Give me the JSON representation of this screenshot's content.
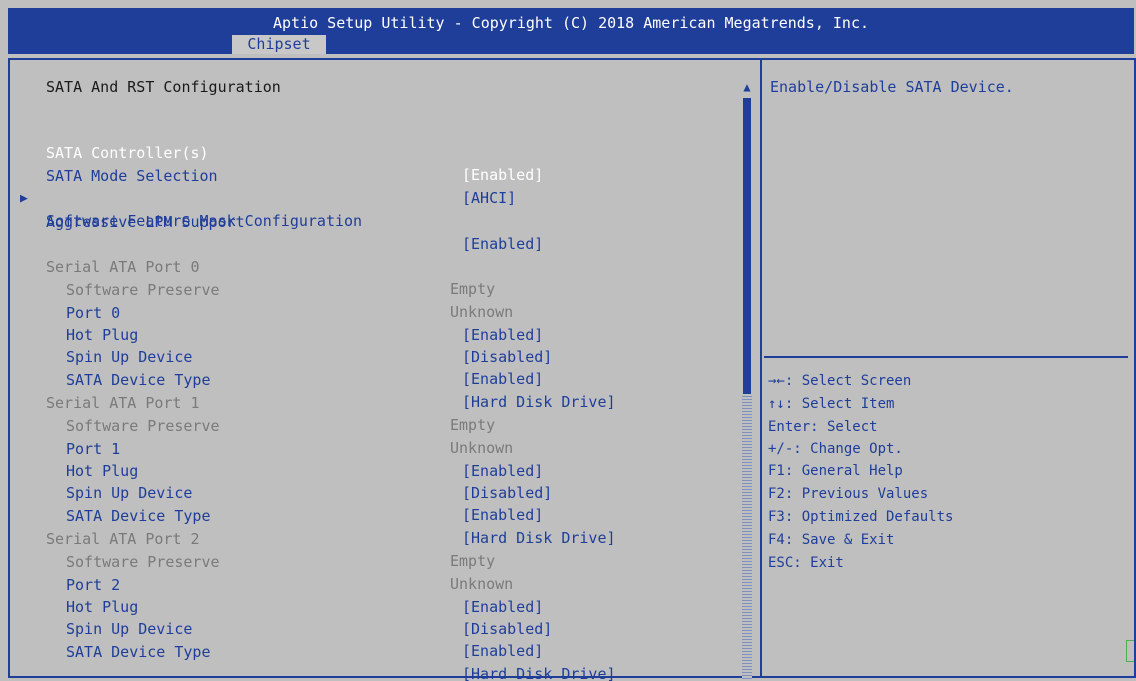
{
  "window": {
    "title": "Aptio Setup Utility - Copyright (C) 2018 American Megatrends, Inc.",
    "active_tab": "Chipset"
  },
  "section_title": "SATA And RST Configuration",
  "items": [
    {
      "label": "SATA Controller(s)",
      "value": "[Enabled]"
    },
    {
      "label": "SATA Mode Selection",
      "value": "[AHCI]"
    },
    {
      "label": "Software Feature Mask Configuration",
      "value": ""
    },
    {
      "label": "Aggressive LPM Support",
      "value": "[Enabled]"
    },
    {
      "label": "Serial ATA Port 0",
      "value": "Empty"
    },
    {
      "label": "Software Preserve",
      "value": "Unknown"
    },
    {
      "label": "Port 0",
      "value": "[Enabled]"
    },
    {
      "label": "Hot Plug",
      "value": "[Disabled]"
    },
    {
      "label": "Spin Up Device",
      "value": "[Enabled]"
    },
    {
      "label": "SATA Device Type",
      "value": "[Hard Disk Drive]"
    },
    {
      "label": "Serial ATA Port 1",
      "value": "Empty"
    },
    {
      "label": "Software Preserve",
      "value": "Unknown"
    },
    {
      "label": "Port 1",
      "value": "[Enabled]"
    },
    {
      "label": "Hot Plug",
      "value": "[Disabled]"
    },
    {
      "label": "Spin Up Device",
      "value": "[Enabled]"
    },
    {
      "label": "SATA Device Type",
      "value": "[Hard Disk Drive]"
    },
    {
      "label": "Serial ATA Port 2",
      "value": "Empty"
    },
    {
      "label": "Software Preserve",
      "value": "Unknown"
    },
    {
      "label": "Port 2",
      "value": "[Enabled]"
    },
    {
      "label": "Hot Plug",
      "value": "[Disabled]"
    },
    {
      "label": "Spin Up Device",
      "value": "[Enabled]"
    },
    {
      "label": "SATA Device Type",
      "value": "[Hard Disk Drive]"
    }
  ],
  "submenu_marker": "▶",
  "scroll": {
    "up": "▲",
    "down": "▼"
  },
  "help": {
    "description": "Enable/Disable SATA Device.",
    "keys": [
      "→←: Select Screen",
      "↑↓: Select Item",
      "Enter: Select",
      "+/-: Change Opt.",
      "F1: General Help",
      "F2: Previous Values",
      "F3: Optimized Defaults",
      "F4: Save & Exit",
      "ESC: Exit"
    ]
  },
  "colors": {
    "header_bg": "#1f3e9a",
    "body_bg": "#bfbfbf",
    "accent": "#1f3e9a",
    "disabled_text": "#7a7a7a",
    "selected_text": "#ffffff"
  }
}
